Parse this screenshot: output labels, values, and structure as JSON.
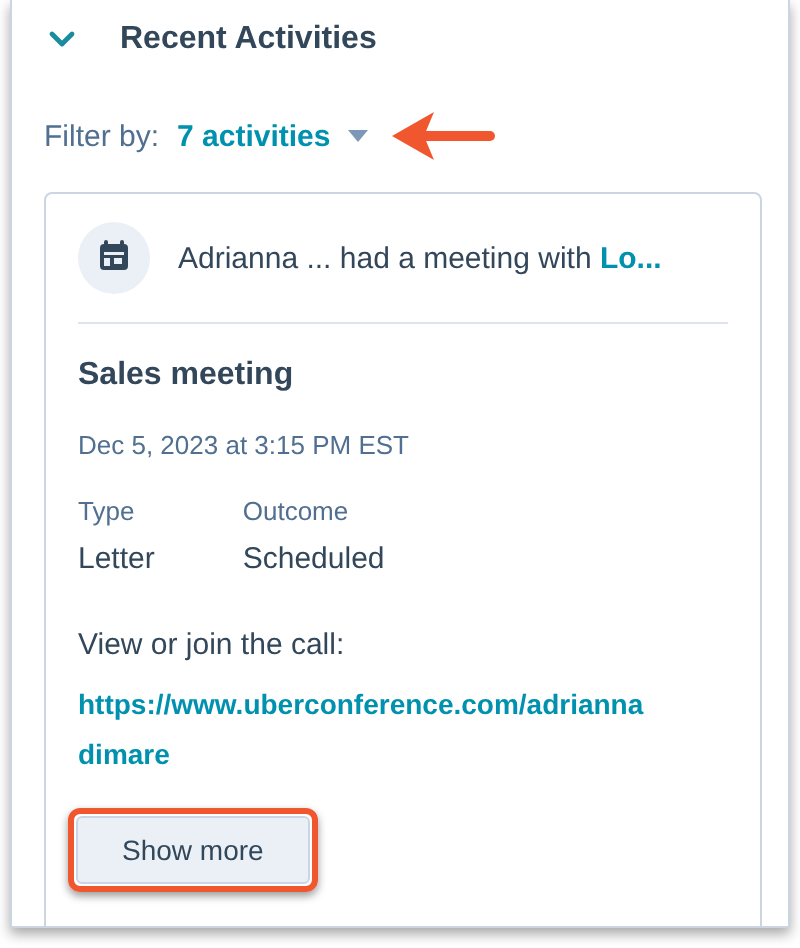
{
  "section": {
    "title": "Recent Activities",
    "expanded": true
  },
  "filter": {
    "label": "Filter by:",
    "value": "7 activities"
  },
  "activity": {
    "actor": "Adrianna ...",
    "action": "had a meeting with",
    "contact": "Lo...",
    "title": "Sales meeting",
    "timestamp": "Dec 5, 2023 at 3:15 PM EST",
    "fields": [
      {
        "label": "Type",
        "value": "Letter"
      },
      {
        "label": "Outcome",
        "value": "Scheduled"
      }
    ],
    "body_label": "View or join the call:",
    "link": "https://www.uberconference.com/adriannadimare",
    "button": "Show more"
  }
}
